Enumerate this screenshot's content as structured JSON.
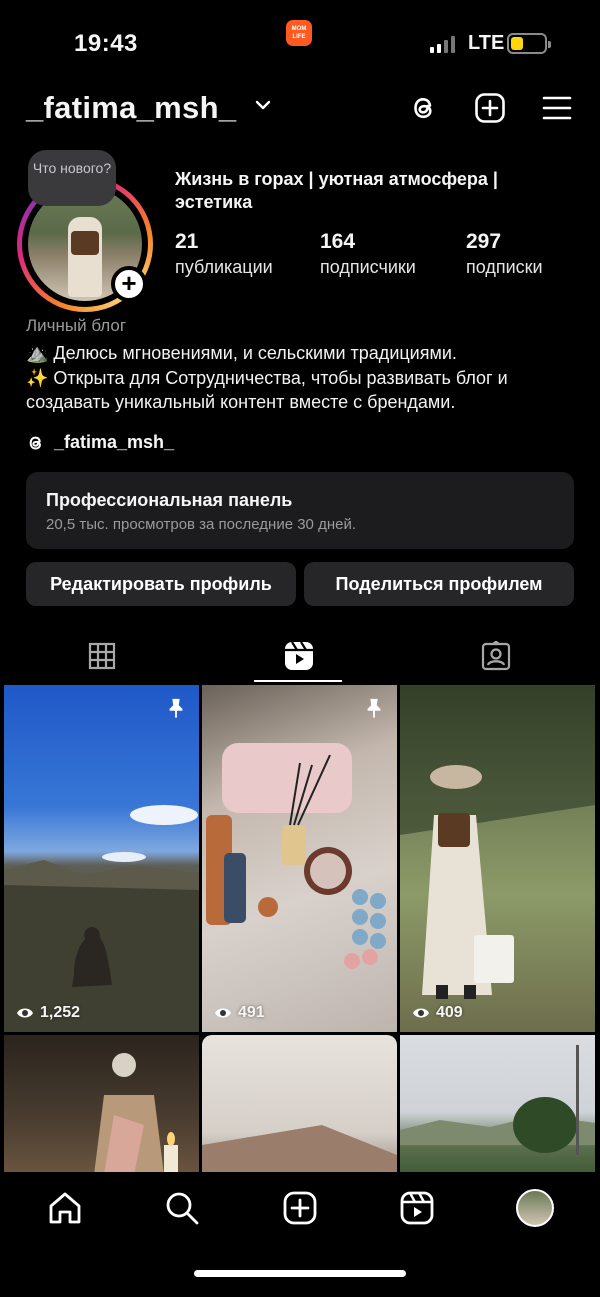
{
  "status_bar": {
    "time": "19:43",
    "app_badge": "MOM LIFE",
    "network": "LTE",
    "battery_level": 0.3
  },
  "header": {
    "username": "_fatima_msh_",
    "icons": [
      "threads-icon",
      "new-post-icon",
      "menu-icon"
    ]
  },
  "profile": {
    "note": "Что нового?",
    "title": "Жизнь в горах | уютная атмосфера | эстетика",
    "stats": [
      {
        "value": "21",
        "label": "публикации"
      },
      {
        "value": "164",
        "label": "подписчики"
      },
      {
        "value": "297",
        "label": "подписки"
      }
    ],
    "category": "Личный блог",
    "bio_line1": "⛰️ Делюсь мгновениями, и сельскими традициями.",
    "bio_line2": "✨ Открыта для Сотрудничества, чтобы развивать блог и создавать уникальный контент вместе с брендами.",
    "threads_handle": "_fatima_msh_"
  },
  "pro_panel": {
    "title": "Профессиональная панель",
    "subtitle": "20,5 тыс. просмотров за последние 30 дней."
  },
  "buttons": {
    "edit": "Редактировать профиль",
    "share": "Поделиться профилем"
  },
  "tabs": [
    "grid-icon",
    "reels-icon",
    "tagged-icon"
  ],
  "active_tab": "reels",
  "reels": [
    {
      "views": "1,252",
      "pinned": true
    },
    {
      "views": "491",
      "pinned": true
    },
    {
      "views": "409",
      "pinned": false
    },
    {
      "views": "",
      "pinned": false
    },
    {
      "views": "",
      "pinned": false
    },
    {
      "views": "",
      "pinned": false
    }
  ],
  "bottom_nav": [
    "home-icon",
    "search-icon",
    "create-icon",
    "reels-nav-icon",
    "profile-avatar"
  ],
  "colors": {
    "background": "#000000",
    "panel": "#1c1c1e",
    "button": "#262628",
    "muted_text": "#9a9a9a",
    "ring_start": "#f58529",
    "ring_mid": "#dd2a7b"
  }
}
